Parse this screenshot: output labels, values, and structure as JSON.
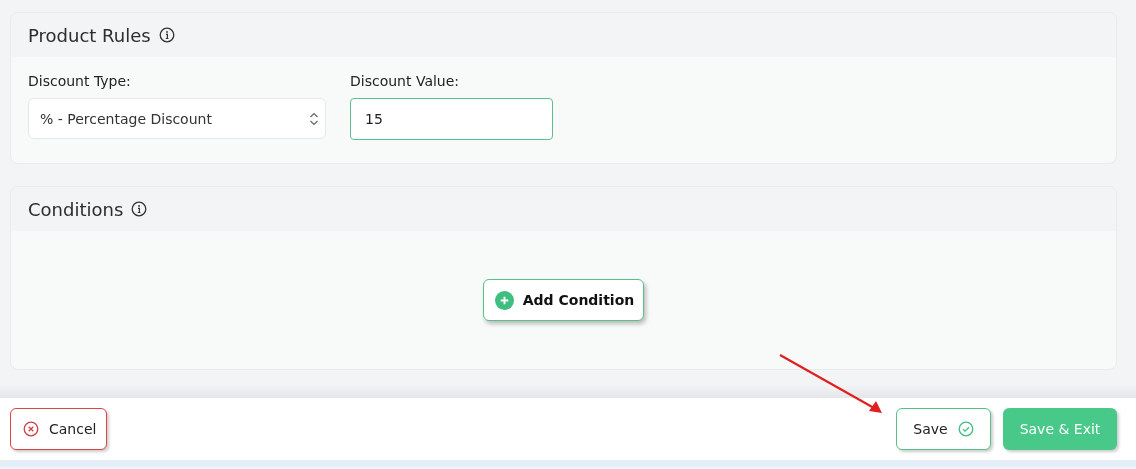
{
  "product_rules": {
    "title": "Product Rules",
    "discount_type": {
      "label": "Discount Type:",
      "value": "% - Percentage Discount"
    },
    "discount_value": {
      "label": "Discount Value:",
      "value": "15",
      "focused": true
    }
  },
  "conditions": {
    "title": "Conditions",
    "add_button": "Add Condition"
  },
  "footer": {
    "cancel": "Cancel",
    "save": "Save",
    "save_exit": "Save & Exit"
  }
}
